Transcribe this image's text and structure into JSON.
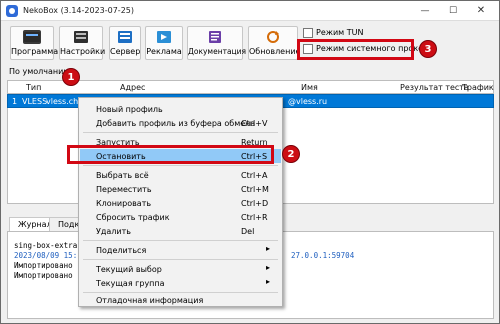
{
  "window": {
    "title": "NekoBox (3.14-2023-07-25)",
    "controls": {
      "minimize": "—",
      "maximize": "☐",
      "close": "✕"
    }
  },
  "toolbar": {
    "program": "Программа",
    "settings": "Настройки",
    "server": "Сервер",
    "ads": "Реклама",
    "docs": "Документация",
    "update": "Обновление"
  },
  "modes": {
    "tun_label": "Режим TUN",
    "system_proxy_label": "Режим системного прокси"
  },
  "group": {
    "default_tab": "По умолчанию"
  },
  "table": {
    "headers": {
      "type": "Тип",
      "address": "Адрес",
      "name": "Имя",
      "test_result": "Результат теста",
      "traffic": "Трафик"
    },
    "row": {
      "index": "1",
      "type": "VLESS",
      "address": "vless.ch",
      "name": "@vless.ru"
    }
  },
  "context_menu": {
    "items": [
      {
        "label": "Новый профиль",
        "shortcut": "",
        "submenu": false
      },
      {
        "label": "Добавить профиль из буфера обмена",
        "shortcut": "Ctrl+V",
        "submenu": false
      },
      {
        "label": "Запустить",
        "shortcut": "Return",
        "submenu": false
      },
      {
        "label": "Остановить",
        "shortcut": "Ctrl+S",
        "submenu": false
      },
      {
        "label": "Выбрать всё",
        "shortcut": "Ctrl+A",
        "submenu": false
      },
      {
        "label": "Переместить",
        "shortcut": "Ctrl+M",
        "submenu": false
      },
      {
        "label": "Клонировать",
        "shortcut": "Ctrl+D",
        "submenu": false
      },
      {
        "label": "Сбросить трафик",
        "shortcut": "Ctrl+R",
        "submenu": false
      },
      {
        "label": "Удалить",
        "shortcut": "Del",
        "submenu": false
      },
      {
        "label": "Поделиться",
        "shortcut": "",
        "submenu": true
      },
      {
        "label": "Текущий выбор",
        "shortcut": "",
        "submenu": true
      },
      {
        "label": "Текущая группа",
        "shortcut": "",
        "submenu": true
      },
      {
        "label": "Отладочная информация",
        "shortcut": "",
        "submenu": false
      }
    ],
    "submenu_arrow": "▸"
  },
  "bottom_tabs": {
    "journal": "Журнал",
    "second_tab": "Подк"
  },
  "log": {
    "line1": "sing-box-extra",
    "line2": "2023/08/09 15:",
    "line2_tail": "27.0.0.1:59704",
    "line3": "Импортировано",
    "line4": "Импортировано"
  },
  "annotations": {
    "one": "1",
    "two": "2",
    "three": "3"
  },
  "colors": {
    "selection": "#0078d7",
    "menu_highlight": "#91c9f7",
    "annotation_red": "#d20814",
    "log_blue": "#1f5fbf"
  }
}
